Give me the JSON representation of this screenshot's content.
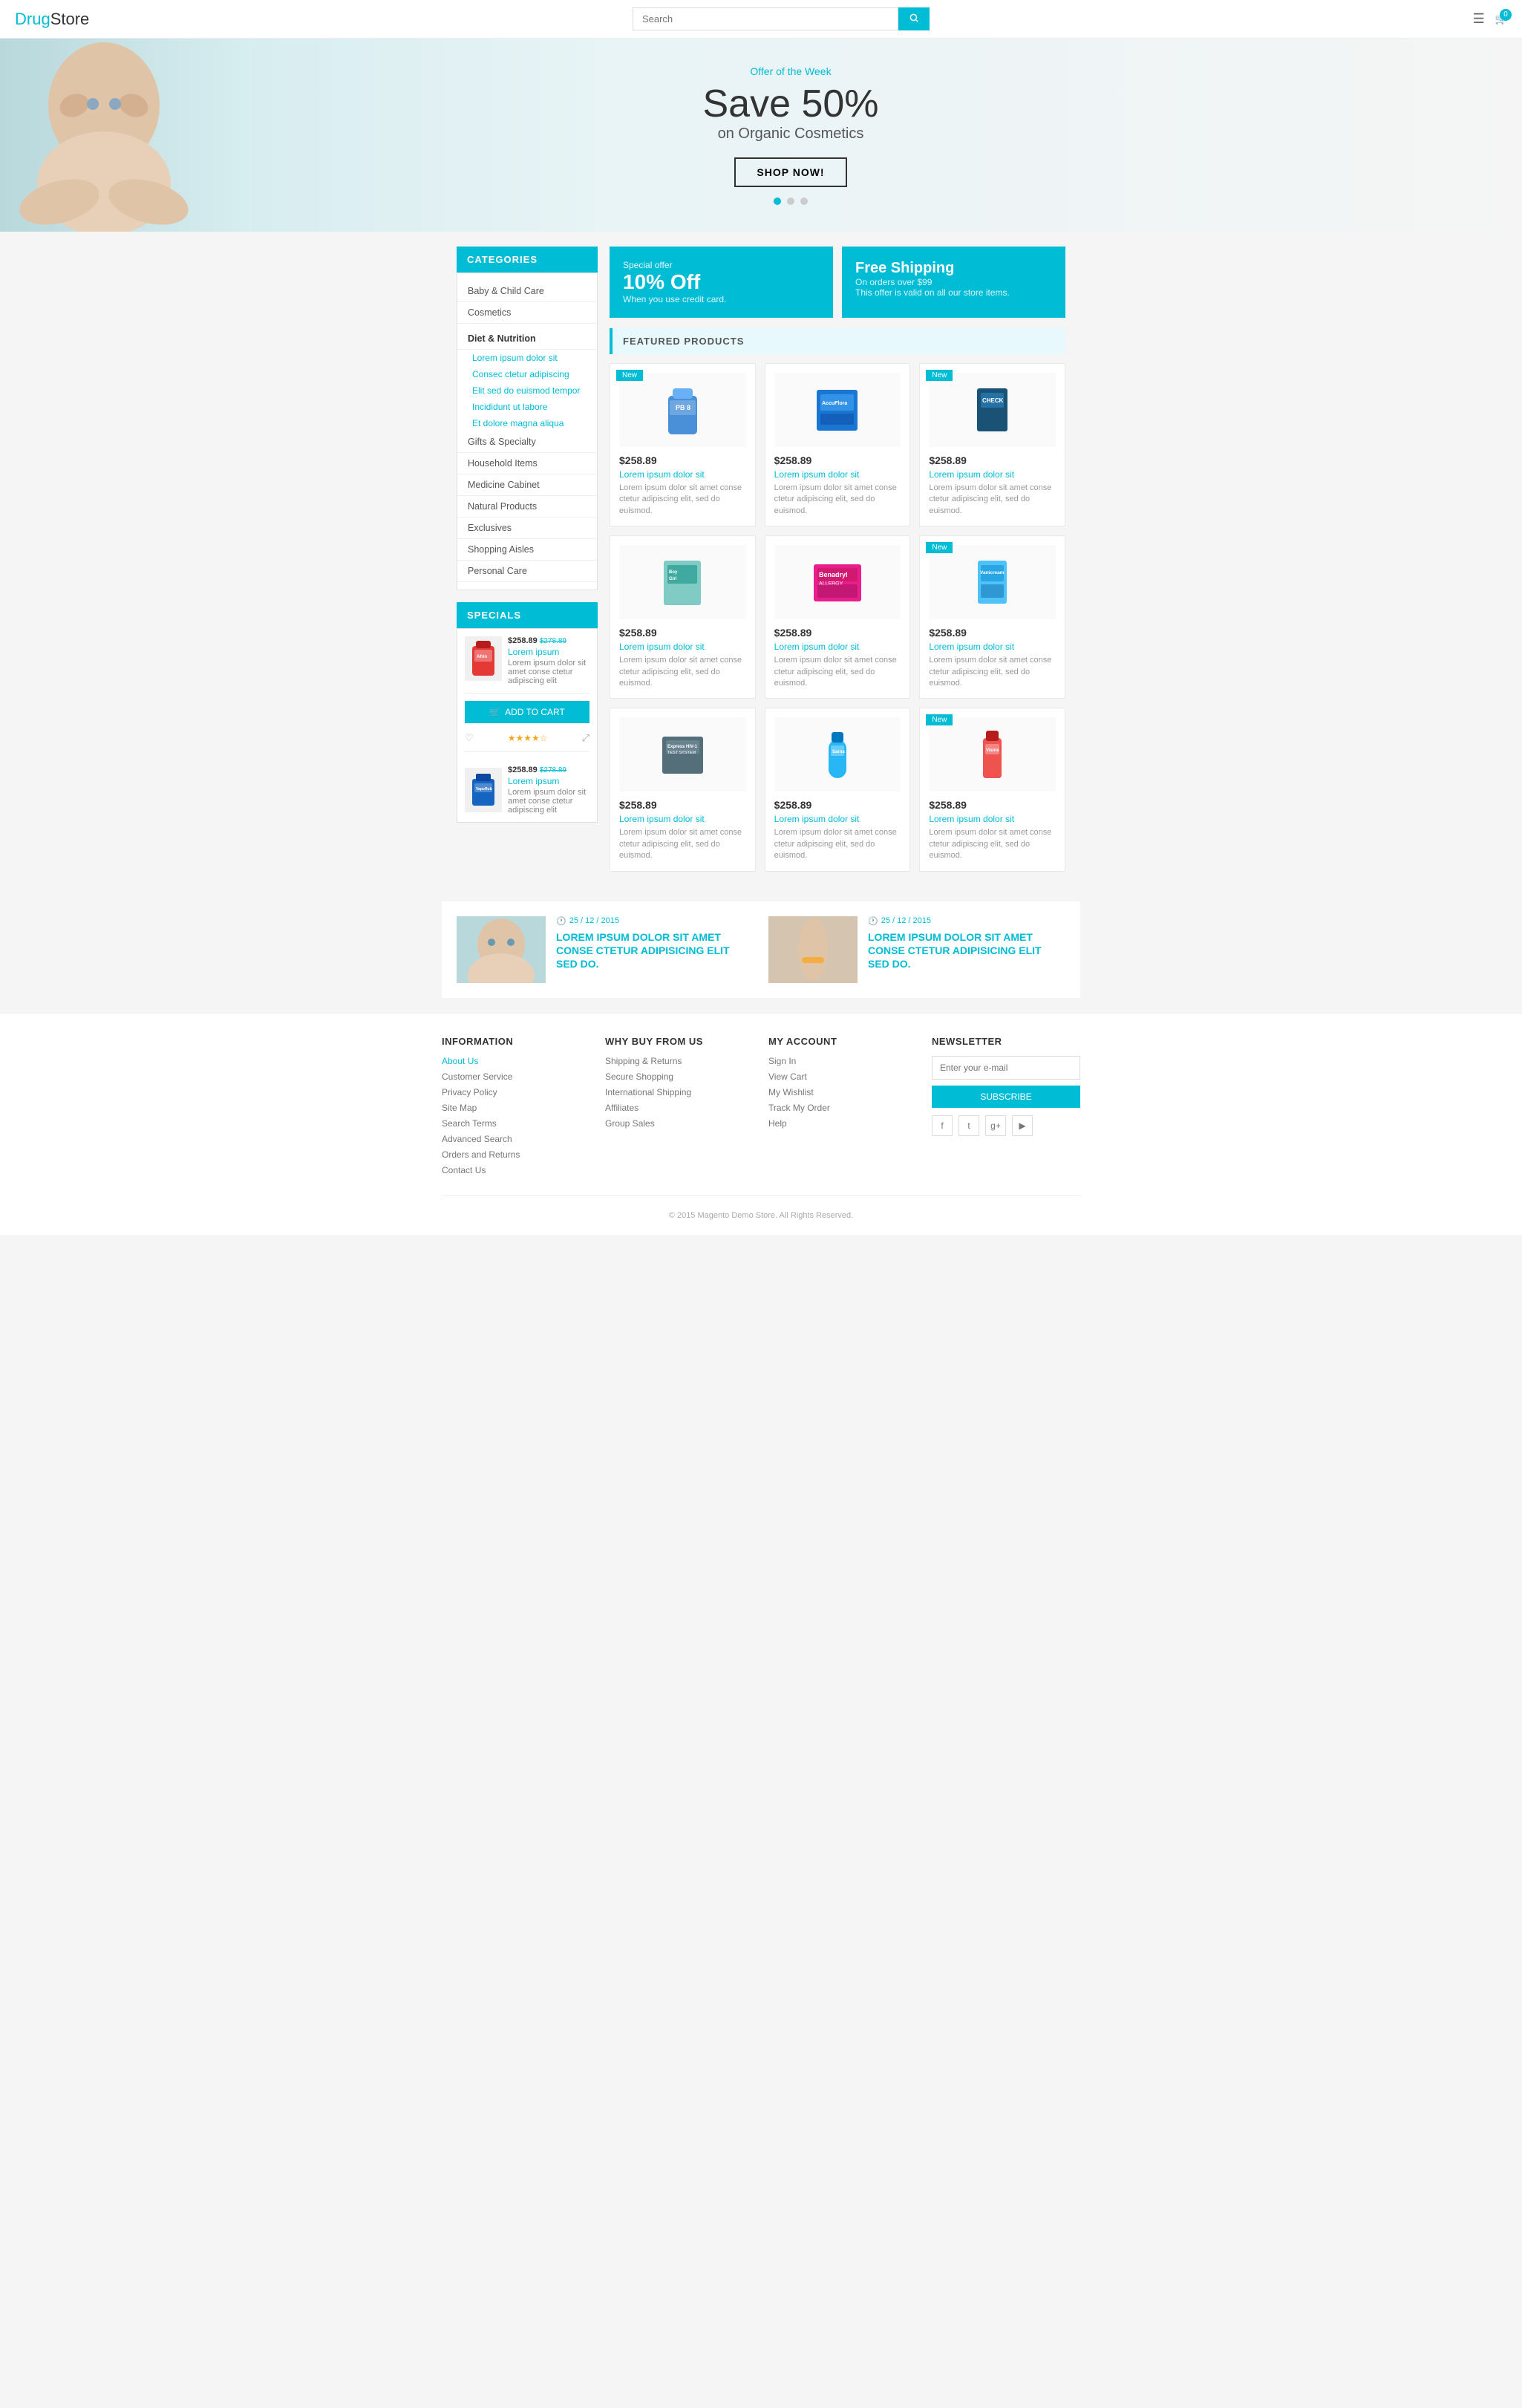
{
  "header": {
    "logo_part1": "Drug",
    "logo_part2": "Store",
    "search_placeholder": "Search",
    "search_button_icon": "🔍",
    "cart_count": "0"
  },
  "hero": {
    "offer_label": "Offer of the Week",
    "title_line1": "Save 50%",
    "title_line2": "on Organic Cosmetics",
    "button_label": "SHOP NOW!"
  },
  "categories": {
    "header": "CATEGORIES",
    "items": [
      {
        "label": "Baby & Child Care",
        "type": "main"
      },
      {
        "label": "Cosmetics",
        "type": "main"
      },
      {
        "label": "Diet & Nutrition",
        "type": "subhead"
      },
      {
        "label": "Lorem ipsum dolor sit",
        "type": "sub"
      },
      {
        "label": "Consec ctetur adipiscing",
        "type": "sub"
      },
      {
        "label": "Elit sed do euismod tempor",
        "type": "sub"
      },
      {
        "label": "Incididunt ut labore",
        "type": "sub"
      },
      {
        "label": "Et dolore magna aliqua",
        "type": "sub"
      },
      {
        "label": "Gifts & Specialty",
        "type": "main"
      },
      {
        "label": "Household Items",
        "type": "main"
      },
      {
        "label": "Medicine Cabinet",
        "type": "main"
      },
      {
        "label": "Natural Products",
        "type": "main"
      },
      {
        "label": "Exclusives",
        "type": "main"
      },
      {
        "label": "Shopping Aisles",
        "type": "main"
      },
      {
        "label": "Personal Care",
        "type": "main"
      }
    ]
  },
  "specials": {
    "header": "SPECIALS",
    "items": [
      {
        "price": "$258.89",
        "old_price": "$278.89",
        "name": "Lorem ipsum",
        "desc": "Lorem ipsum dolor sit amet conse ctetur adipiscing elit",
        "add_to_cart": "ADD TO CART"
      },
      {
        "price": "$258.89",
        "old_price": "$278.89",
        "name": "Lorem ipsum",
        "desc": "Lorem ipsum dolor sit amet conse ctetur adipiscing elit"
      }
    ],
    "stars": "★★★★☆"
  },
  "promo": {
    "left": {
      "label": "Special offer",
      "big": "10% Off",
      "sub": "When you use credit card."
    },
    "right": {
      "big": "Free Shipping",
      "line1": "On orders over $99",
      "line2": "This offer is valid on all our store items."
    }
  },
  "featured": {
    "header": "FEATURED PRODUCTS",
    "products": [
      {
        "badge": "New",
        "price": "$258.89",
        "name": "Lorem ipsum dolor sit",
        "desc": "Lorem ipsum dolor sit amet conse ctetur adipiscing elit, sed do euismod."
      },
      {
        "badge": "",
        "price": "$258.89",
        "name": "Lorem ipsum dolor sit",
        "desc": "Lorem ipsum dolor sit amet conse ctetur adipiscing elit, sed do euismod."
      },
      {
        "badge": "New",
        "price": "$258.89",
        "name": "Lorem ipsum dolor sit",
        "desc": "Lorem ipsum dolor sit amet conse ctetur adipiscing elit, sed do euismod."
      },
      {
        "badge": "",
        "price": "$258.89",
        "name": "Lorem ipsum dolor sit",
        "desc": "Lorem ipsum dolor sit amet conse ctetur adipiscing elit, sed do euismod."
      },
      {
        "badge": "",
        "price": "$258.89",
        "name": "Lorem ipsum dolor sit",
        "desc": "Lorem ipsum dolor sit amet conse ctetur adipiscing elit, sed do euismod."
      },
      {
        "badge": "New",
        "price": "$258.89",
        "name": "Lorem ipsum dolor sit",
        "desc": "Lorem ipsum dolor sit amet conse ctetur adipiscing elit, sed do euismod."
      },
      {
        "badge": "",
        "price": "$258.89",
        "name": "Lorem ipsum dolor sit",
        "desc": "Lorem ipsum dolor sit amet conse ctetur adipiscing elit, sed do euismod."
      },
      {
        "badge": "",
        "price": "$258.89",
        "name": "Lorem ipsum dolor sit",
        "desc": "Lorem ipsum dolor sit amet conse ctetur adipiscing elit, sed do euismod."
      },
      {
        "badge": "New",
        "price": "$258.89",
        "name": "Lorem ipsum dolor sit",
        "desc": "Lorem ipsum dolor sit amet conse ctetur adipiscing elit, sed do euismod."
      }
    ]
  },
  "blog": {
    "posts": [
      {
        "date": "25 / 12 / 2015",
        "title": "LOREM IPSUM DOLOR SIT AMET CONSE CTETUR ADIPISICING ELIT SED DO."
      },
      {
        "date": "25 / 12 / 2015",
        "title": "LOREM IPSUM DOLOR SIT AMET CONSE CTETUR ADIPISICING ELIT SED DO."
      }
    ]
  },
  "footer": {
    "information": {
      "header": "INFORMATION",
      "links": [
        "About Us",
        "Customer Service",
        "Privacy Policy",
        "Site Map",
        "Search Terms",
        "Advanced Search",
        "Orders and Returns",
        "Contact Us"
      ]
    },
    "why": {
      "header": "WHY BUY FROM US",
      "links": [
        "Shipping & Returns",
        "Secure Shopping",
        "International Shipping",
        "Affiliates",
        "Group Sales"
      ]
    },
    "account": {
      "header": "MY ACCOUNT",
      "links": [
        "Sign In",
        "View Cart",
        "My Wishlist",
        "Track My Order",
        "Help"
      ]
    },
    "newsletter": {
      "header": "NEWSLETTER",
      "placeholder": "Enter your e-mail",
      "button": "SUBSCRIBE"
    },
    "social": [
      "f",
      "t",
      "g+",
      "▶"
    ],
    "copyright": "© 2015 Magento Demo Store. All Rights Reserved."
  }
}
